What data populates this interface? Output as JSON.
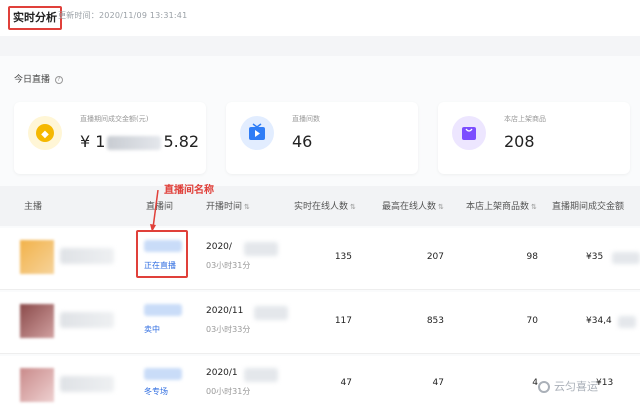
{
  "header": {
    "tab_realtime": "实时分析",
    "update_time": "更新时间：2020/11/09 13:31:41"
  },
  "section": {
    "title": "今日直播",
    "help_icon": "question-circle-icon"
  },
  "cards": [
    {
      "label": "直播期间成交金额(元)",
      "value_prefix": "¥ 1",
      "value_suffix": "5.82",
      "icon": "coin-icon",
      "color": "#f5b800"
    },
    {
      "label": "直播间数",
      "value": "46",
      "icon": "tv-play-icon",
      "color": "#2f7df6"
    },
    {
      "label": "本店上架商品",
      "value": "208",
      "icon": "shopping-bag-icon",
      "color": "#7c4dff"
    }
  ],
  "annotation": {
    "label": "直播间名称"
  },
  "table": {
    "columns": [
      "主播",
      "直播间",
      "开播时间",
      "实时在线人数",
      "最高在线人数",
      "本店上架商品数",
      "直播期间成交金额"
    ],
    "sort_icon": "sort-icon",
    "rows": [
      {
        "status": "正在直播",
        "start": "2020/",
        "duration": "03小时31分",
        "online": "135",
        "peak": "207",
        "items": "98",
        "gmv": "¥35"
      },
      {
        "status": "卖中",
        "start": "2020/11",
        "duration": "03小时33分",
        "online": "117",
        "peak": "853",
        "items": "70",
        "gmv": "¥34,4"
      },
      {
        "status": "冬专场",
        "start": "2020/1",
        "duration": "00小时31分",
        "online": "47",
        "peak": "47",
        "items": "4",
        "gmv": "¥13"
      }
    ]
  },
  "watermark": "云匀喜运"
}
